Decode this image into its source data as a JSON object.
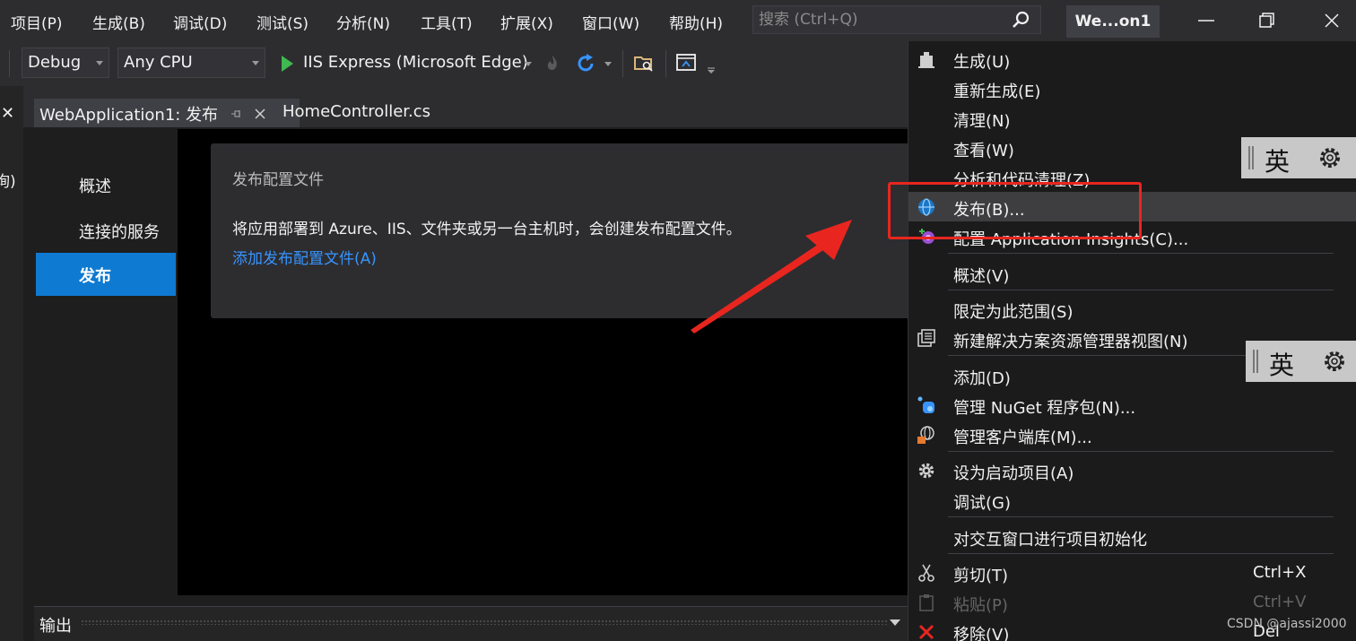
{
  "menubar": {
    "items": [
      "项目(P)",
      "生成(B)",
      "调试(D)",
      "测试(S)",
      "分析(N)",
      "工具(T)",
      "扩展(X)",
      "窗口(W)",
      "帮助(H)"
    ],
    "search_placeholder": "搜索 (Ctrl+Q)",
    "solution_name": "We...on1"
  },
  "toolbar": {
    "config": "Debug",
    "platform": "Any CPU",
    "run_target": "IIS Express (Microsoft Edge)"
  },
  "tabs": {
    "active": "WebApplication1: 发布",
    "inactive": "HomeController.cs"
  },
  "left_strip": {
    "close": "✕",
    "fragment": "询)"
  },
  "nav": {
    "items": [
      "概述",
      "连接的服务",
      "发布"
    ],
    "active": "发布"
  },
  "publish_card": {
    "title": "发布配置文件",
    "description": "将应用部署到 Azure、IIS、文件夹或另一台主机时，会创建发布配置文件。",
    "link": "添加发布配置文件(A)"
  },
  "output": {
    "label": "输出"
  },
  "context_menu": {
    "items": [
      {
        "label": "生成(U)",
        "icon": "build-icon"
      },
      {
        "label": "重新生成(E)"
      },
      {
        "label": "清理(N)"
      },
      {
        "label": "查看(W)"
      },
      {
        "label": "分析和代码清理(Z)"
      },
      {
        "label": "发布(B)...",
        "icon": "globe-publish-icon",
        "highlighted": true
      },
      {
        "label": "配置 Application Insights(C)...",
        "icon": "app-insights-icon"
      },
      {
        "label": "概述(V)"
      },
      {
        "label": "限定为此范围(S)"
      },
      {
        "label": "新建解决方案资源管理器视图(N)",
        "icon": "new-view-icon"
      },
      {
        "label": "添加(D)"
      },
      {
        "label": "管理 NuGet 程序包(N)...",
        "icon": "nuget-icon"
      },
      {
        "label": "管理客户端库(M)...",
        "icon": "client-library-icon"
      },
      {
        "label": "设为启动项目(A)",
        "icon": "gear-icon"
      },
      {
        "label": "调试(G)"
      },
      {
        "label": "对交互窗口进行项目初始化"
      },
      {
        "label": "剪切(T)",
        "shortcut": "Ctrl+X",
        "icon": "scissors-icon"
      },
      {
        "label": "粘贴(P)",
        "shortcut": "Ctrl+V",
        "icon": "paste-icon",
        "disabled": true
      },
      {
        "label": "移除(V)",
        "shortcut": "Del",
        "icon": "delete-icon"
      }
    ]
  },
  "ime": {
    "char": "英"
  },
  "watermark": "CSDN @ajassi2000",
  "colors": {
    "accent": "#0e7ad1",
    "link": "#3794ff",
    "annotation_red": "#e8261f"
  }
}
